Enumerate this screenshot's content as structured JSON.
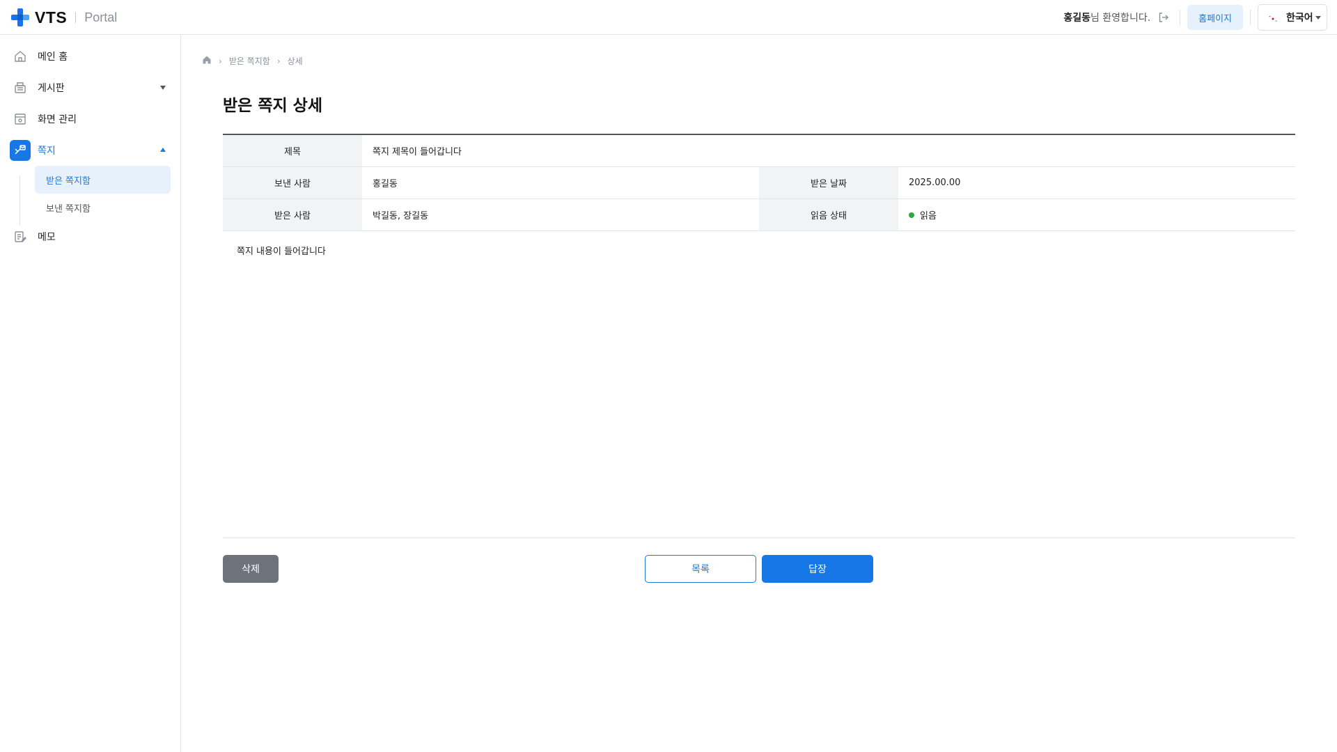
{
  "header": {
    "logo_text": "VTS",
    "logo_sub": "Portal",
    "user_name": "홍길동",
    "welcome_suffix": "님 환영합니다.",
    "home_button": "홈페이지",
    "language": "한국어"
  },
  "sidebar": {
    "items": [
      {
        "label": "메인 홈",
        "icon": "home-icon"
      },
      {
        "label": "게시판",
        "icon": "board-icon"
      },
      {
        "label": "화면 관리",
        "icon": "screen-icon"
      },
      {
        "label": "쪽지",
        "icon": "message-icon"
      },
      {
        "label": "메모",
        "icon": "memo-icon"
      }
    ],
    "sub_items": [
      {
        "label": "받은 쪽지함",
        "active": true
      },
      {
        "label": "보낸 쪽지함",
        "active": false
      }
    ]
  },
  "breadcrumb": {
    "items": [
      "받은 쪽지함",
      "상세"
    ]
  },
  "page": {
    "title": "받은 쪽지 상세"
  },
  "detail": {
    "subject_label": "제목",
    "subject_value": "쪽지 제목이 들어갑니다",
    "sender_label": "보낸 사람",
    "sender_value": "홍길동",
    "date_label": "받은 날짜",
    "date_value": "2025.00.00",
    "recipient_label": "받은 사람",
    "recipient_value": "박길동, 장길동",
    "status_label": "읽음 상태",
    "status_value": "읽음",
    "status_color": "#27a943",
    "body": "쪽지 내용이 들어갑니다"
  },
  "actions": {
    "delete": "삭제",
    "list": "목록",
    "reply": "답장"
  },
  "colors": {
    "accent": "#1877e6",
    "accent_light": "#e6f1fc"
  }
}
